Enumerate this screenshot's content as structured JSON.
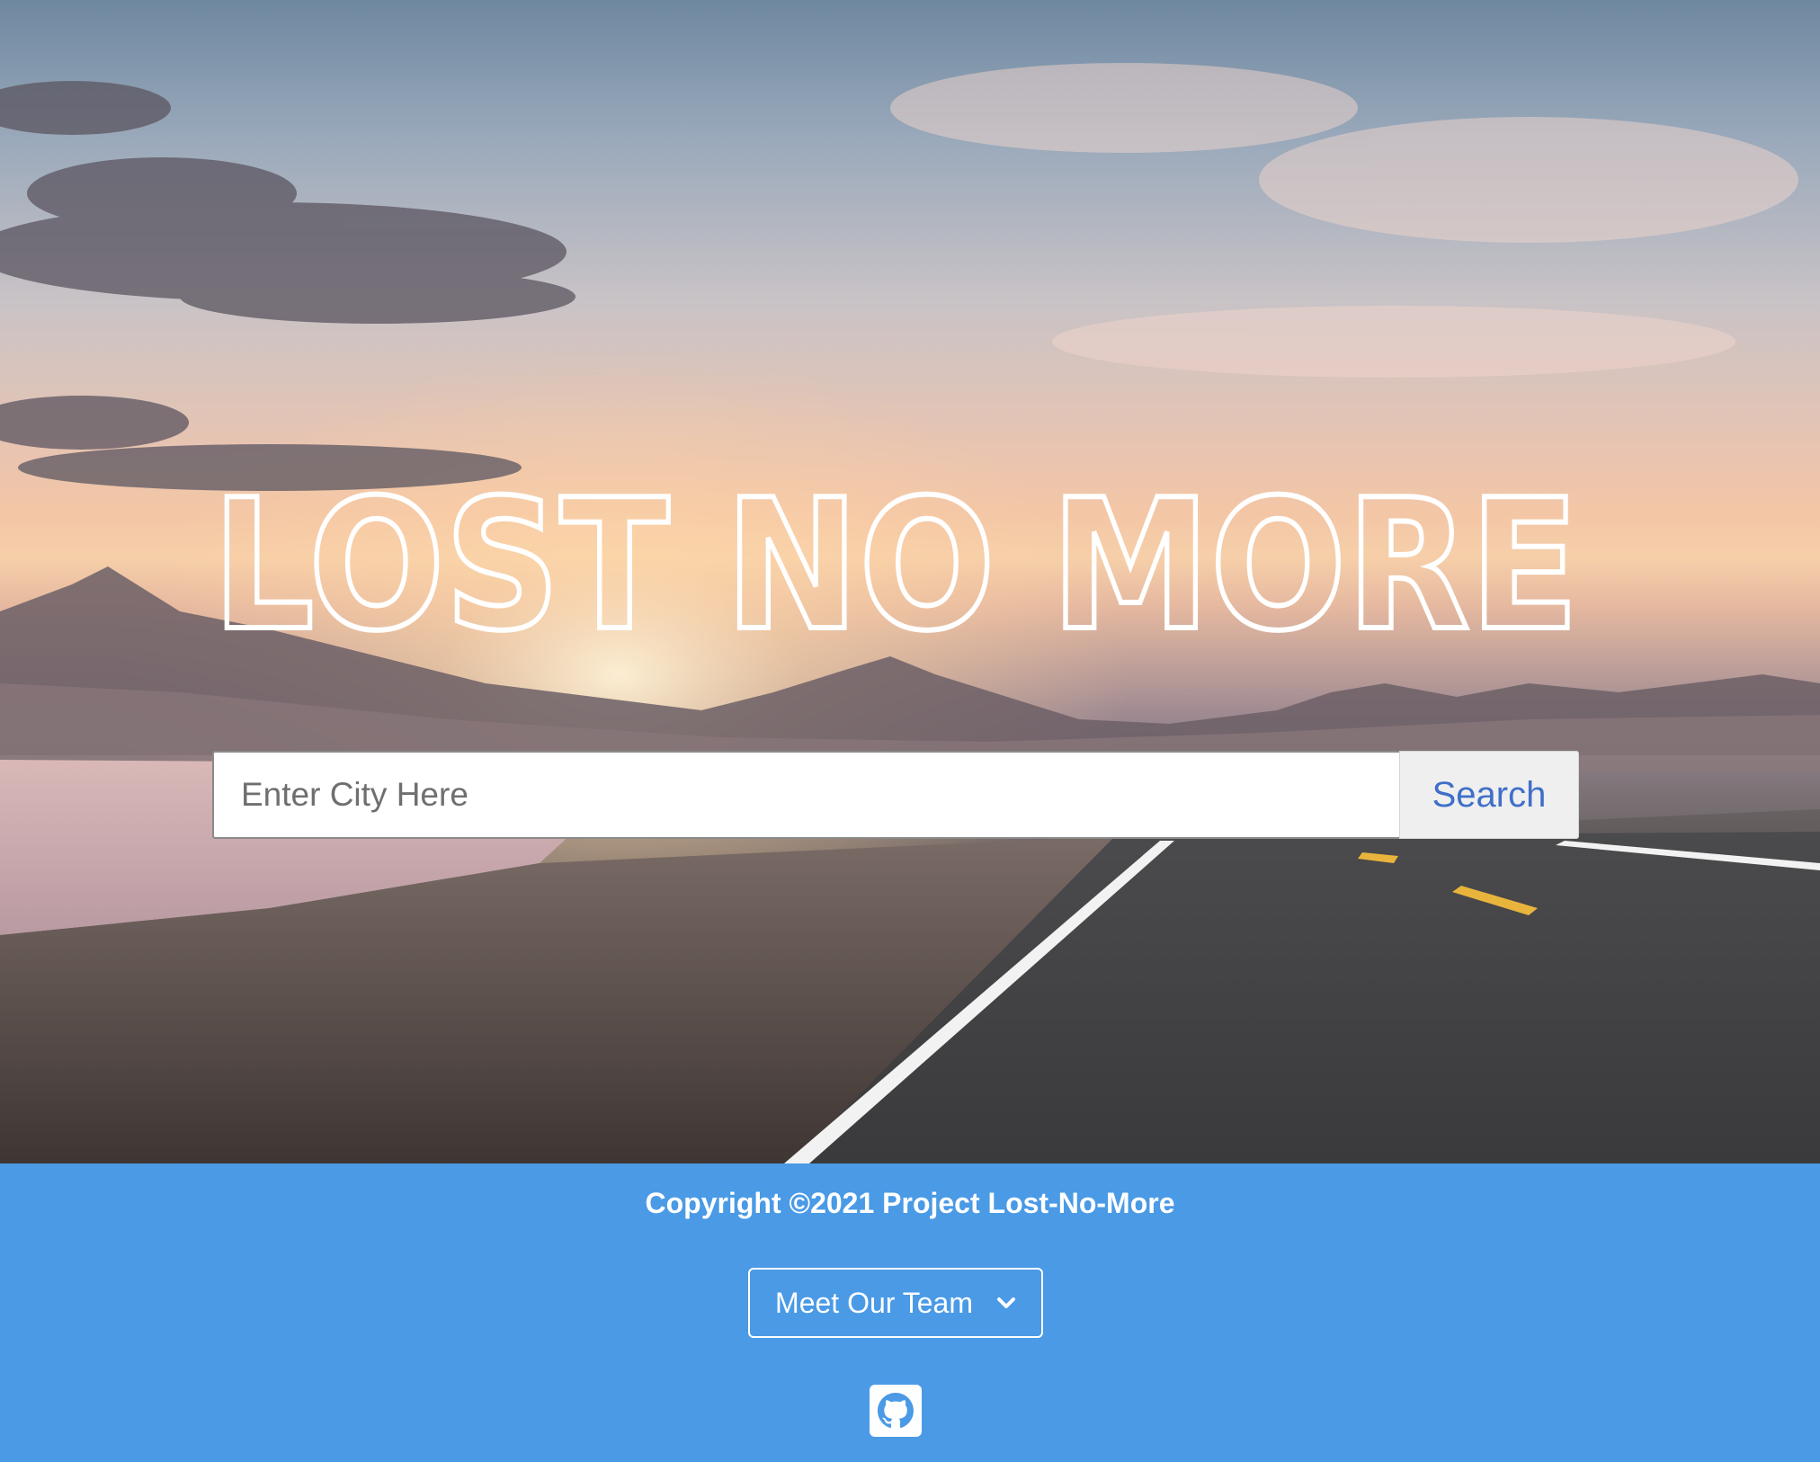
{
  "app": {
    "title": "Lost No More"
  },
  "hero": {
    "logo_text": "LOST NO MORE",
    "background": "sunset-road-landscape"
  },
  "search": {
    "placeholder": "Enter City Here",
    "value": "",
    "button_label": "Search"
  },
  "footer": {
    "copyright": "Copyright ©2021 Project Lost-No-More",
    "team_dropdown_label": "Meet Our Team",
    "team_dropdown_icon": "chevron-down-icon",
    "github_icon": "github-icon"
  },
  "colors": {
    "footer_bg": "#4a9ae6",
    "search_button_text": "#3f6fc9",
    "search_button_bg": "#efefef",
    "logo": "#ffffff"
  }
}
